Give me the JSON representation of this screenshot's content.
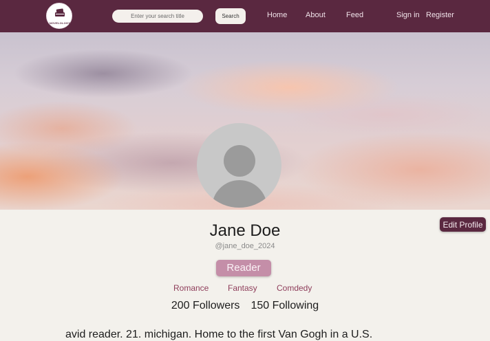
{
  "header": {
    "logo_text": "NOVELOLOGY",
    "search": {
      "placeholder": "Enter your search title",
      "value": ""
    },
    "search_button_label": "Search",
    "nav": {
      "home": "Home",
      "about": "About",
      "feed": "Feed"
    },
    "auth": {
      "sign_in": "Sign in",
      "register": "Register"
    }
  },
  "profile": {
    "name": "Jane Doe",
    "handle": "@jane_doe_2024",
    "edit_profile_label": "Edit Profile",
    "role": "Reader",
    "genres": [
      "Romance",
      "Fantasy",
      "Comdedy"
    ],
    "followers_text": "200 Followers",
    "following_text": "150 Following",
    "bio": "avid reader.  21. michigan. Home to the first Van Gogh in a U.S."
  },
  "icons": {
    "logo": "book-stack-icon",
    "avatar": "default-user-avatar-icon"
  },
  "colors": {
    "header": "#5a2840",
    "badge": "#c48ea8",
    "genre_text": "#8e3d5a",
    "page_bg": "#f3f1ec"
  }
}
